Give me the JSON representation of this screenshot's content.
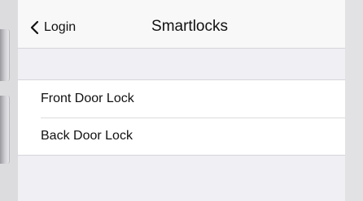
{
  "nav": {
    "back_label": "Login",
    "title": "Smartlocks"
  },
  "locks": [
    {
      "label": "Front Door Lock"
    },
    {
      "label": "Back Door Lock"
    }
  ],
  "colors": {
    "background": "#efeff4",
    "nav_background": "#f8f8f8",
    "cell_background": "#ffffff",
    "separator": "#d6d6da",
    "text": "#111111"
  }
}
